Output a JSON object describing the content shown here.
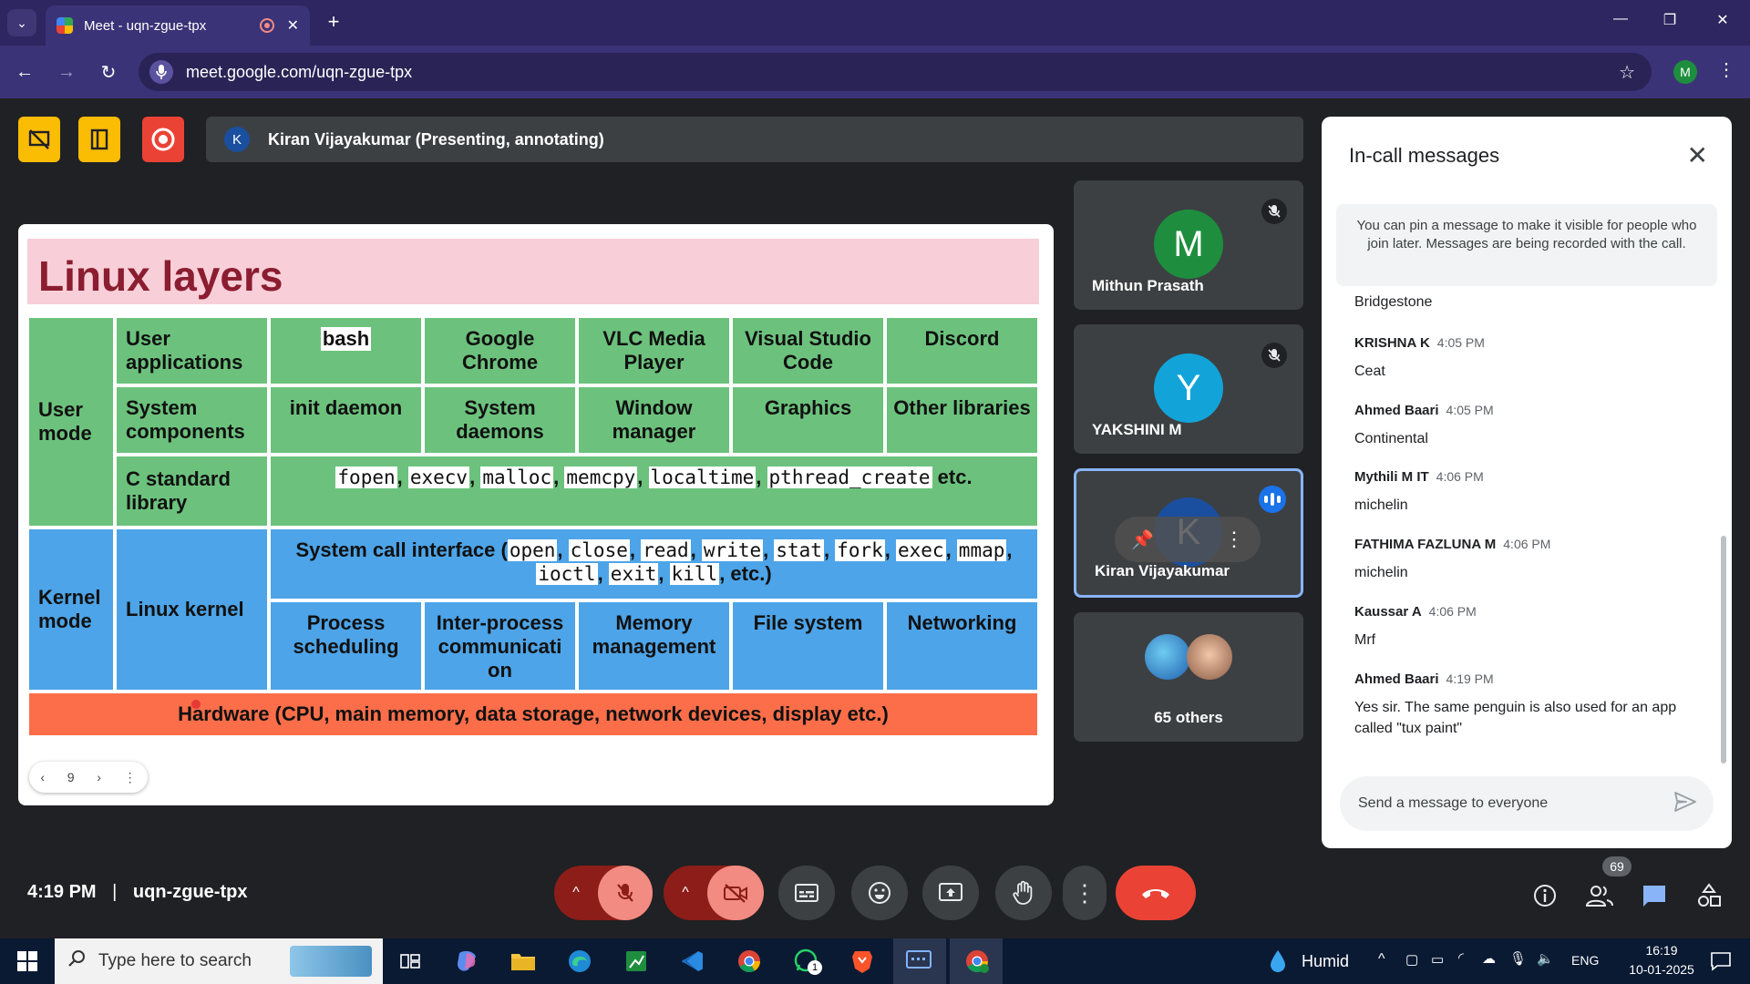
{
  "browser": {
    "tab_title": "Meet - uqn-zgue-tpx",
    "url": "meet.google.com/uqn-zgue-tpx",
    "profile_initial": "M"
  },
  "meet": {
    "presenting_label": "Kiran Vijayakumar (Presenting, annotating)",
    "presenter_initial": "K",
    "time": "4:19 PM",
    "separator": "|",
    "meeting_code": "uqn-zgue-tpx",
    "people_count": "69"
  },
  "slide": {
    "title": "Linux layers",
    "page": "9",
    "user_mode": "User mode",
    "kernel_mode": "Kernel mode",
    "user_apps": "User applications",
    "apps": [
      "bash",
      "Google Chrome",
      "VLC Media Player",
      "Visual Studio Code",
      "Discord"
    ],
    "system_components": "System components",
    "components": [
      "init daemon",
      "System daemons",
      "Window manager",
      "Graphics",
      "Other libraries"
    ],
    "c_library": "C standard library",
    "c_funcs": [
      "fopen",
      "execv",
      "malloc",
      "memcpy",
      "localtime",
      "pthread_create"
    ],
    "c_funcs_suffix": " etc.",
    "syscall_prefix": "System call interface (",
    "syscalls": [
      "open",
      "close",
      "read",
      "write",
      "stat",
      "fork",
      "exec",
      "mmap",
      "ioctl",
      "exit",
      "kill"
    ],
    "syscall_suffix": ", etc.)",
    "linux_kernel": "Linux kernel",
    "kernel_parts": [
      "Process scheduling",
      "Inter-process communicati on",
      "Memory management",
      "File system",
      "Networking"
    ],
    "hardware": "Hardware (CPU, main memory, data storage, network devices, display etc.)"
  },
  "participants": [
    {
      "name": "Mithun Prasath",
      "initial": "M",
      "color": "#1e8e3e"
    },
    {
      "name": "YAKSHINI M",
      "initial": "Y",
      "color": "#12a4d9"
    },
    {
      "name": "Kiran Vijayakumar",
      "initial": "K",
      "color": "#1a4fa0"
    },
    {
      "name": "65 others"
    }
  ],
  "chat": {
    "title": "In-call messages",
    "pin_note": "You can pin a message to make it visible for people who join later. Messages are being recorded with the call.",
    "partial_top": "Bridgestone",
    "messages": [
      {
        "sender": "KRISHNA K",
        "time": "4:05 PM",
        "text": "Ceat"
      },
      {
        "sender": "Ahmed Baari",
        "time": "4:05 PM",
        "text": "Continental"
      },
      {
        "sender": "Mythili M IT",
        "time": "4:06 PM",
        "text": "michelin"
      },
      {
        "sender": "FATHIMA FAZLUNA M",
        "time": "4:06 PM",
        "text": "michelin"
      },
      {
        "sender": "Kaussar A",
        "time": "4:06 PM",
        "text": "Mrf"
      },
      {
        "sender": "Ahmed Baari",
        "time": "4:19 PM",
        "text": "Yes sir. The same penguin is also used for an app called \"tux paint\""
      }
    ],
    "input_placeholder": "Send a message to everyone"
  },
  "taskbar": {
    "search_placeholder": "Type here to search",
    "weather": "Humid",
    "lang": "ENG",
    "time": "16:19",
    "date": "10-01-2025",
    "whatsapp_badge": "1"
  },
  "colors": {
    "end_call": "#ea4335",
    "muted": "#8c1d18",
    "presenting_host": "#fbbc04"
  }
}
